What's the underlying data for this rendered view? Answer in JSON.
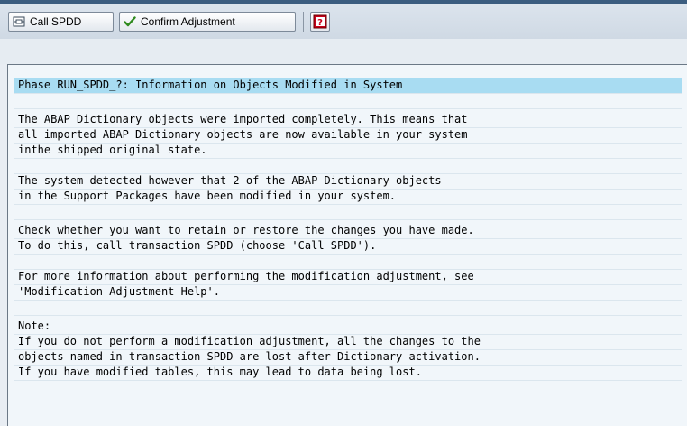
{
  "toolbar": {
    "call_spdd_label": "Call SPDD",
    "confirm_label": "Confirm Adjustment"
  },
  "content": {
    "lines": [
      "Phase RUN_SPDD_?: Information on Objects Modified in System",
      "",
      "The ABAP Dictionary objects were imported completely. This means that",
      "all imported ABAP Dictionary objects are now available in your system",
      "inthe shipped original state.",
      "",
      "The system detected however that 2 of the ABAP Dictionary objects",
      "in the Support Packages have been modified in your system.",
      "",
      "Check whether you want to retain or restore the changes you have made.",
      "To do this, call transaction SPDD (choose 'Call SPDD').",
      "",
      "For more information about performing the modification adjustment, see",
      "'Modification Adjustment Help'.",
      "",
      "Note:",
      "If you do not perform a modification adjustment, all the changes to the",
      "objects named in transaction SPDD are lost after Dictionary activation.",
      "If you have modified tables, this may lead to data being lost."
    ]
  },
  "colors": {
    "highlight": "#a8dcf2",
    "panel_bg": "#f1f6fa",
    "toolbar_bg": "#d6dfe9"
  }
}
